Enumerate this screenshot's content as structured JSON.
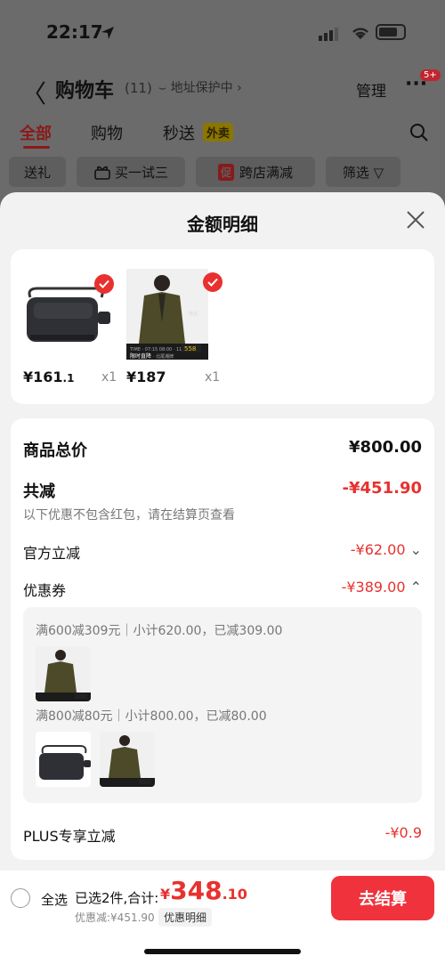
{
  "status": {
    "time": "22:17"
  },
  "header": {
    "back": "〈",
    "title": "购物车",
    "count": "(11)",
    "protect": "⌣ 地址保护中 ›",
    "manage": "管理",
    "more": "···",
    "badge": "5+"
  },
  "tabs": [
    {
      "label": "全部"
    },
    {
      "label": "购物"
    },
    {
      "label": "秒送"
    }
  ],
  "tab_tag": "外卖",
  "chips": [
    {
      "label": "送礼"
    },
    {
      "label": "买一试三"
    },
    {
      "label": "跨店满减",
      "tag": "促"
    },
    {
      "label": "筛选 ▽"
    }
  ],
  "sheet": {
    "title": "金额明细",
    "products": [
      {
        "name": "camera-bag",
        "price_int": "¥161",
        "price_dec": ".1",
        "qty": "x1"
      },
      {
        "name": "coat",
        "price_int": "¥187",
        "price_dec": "",
        "qty": "x1"
      }
    ],
    "coat_banner": "限时直降",
    "coat_price_tag": "558",
    "coat_banner_small": "TIME · 07:15  08:00 · 11:20  558",
    "coat_banner_sub": "· 北尾潮牌",
    "coat_side_text": "精选",
    "total_label": "商品总价",
    "total_value": "¥800.00",
    "reduce_label": "共减",
    "reduce_value": "-¥451.90",
    "reduce_note": "以下优惠不包含红包，请在结算页查看",
    "official_label": "官方立减",
    "official_value": "-¥62.00",
    "official_chevron": "⌄",
    "coupon_label": "优惠券",
    "coupon_value": "-¥389.00",
    "coupon_chevron": "⌃",
    "coupons": [
      {
        "text": "满600减309元｜小计620.00，已减309.00"
      },
      {
        "text": "满800减80元｜小计800.00，已减80.00"
      }
    ],
    "plus_label": "PLUS专享立减",
    "plus_value": "-¥0.9"
  },
  "bottom": {
    "select_all": "全选",
    "selected": "已选2件,合计:",
    "total_yen": "¥",
    "total_int": "348",
    "total_dec": ".10",
    "discount": "优惠减:¥451.90",
    "discount_btn": "优惠明细",
    "checkout": "去结算"
  }
}
